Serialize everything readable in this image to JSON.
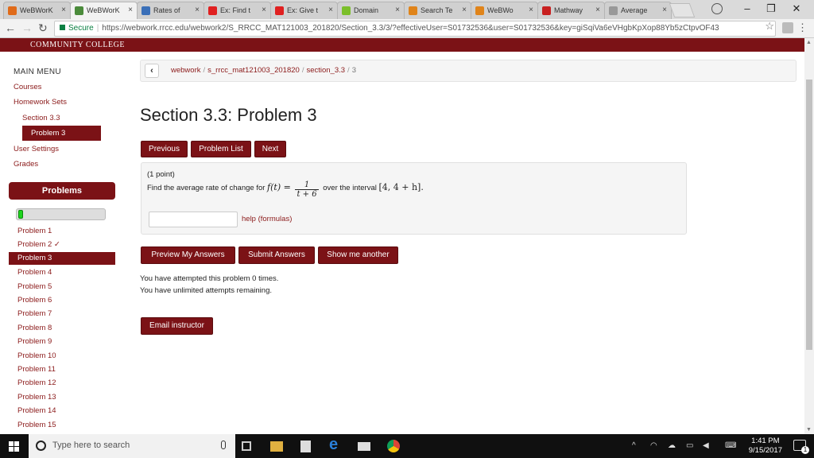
{
  "browser": {
    "tabs": [
      {
        "label": "WeBWorK",
        "favicon_color": "#e06b1a",
        "active": false
      },
      {
        "label": "WeBWorK",
        "favicon_color": "#4b8b3b",
        "active": true
      },
      {
        "label": "Rates of",
        "favicon_color": "#3a6fb8",
        "active": false
      },
      {
        "label": "Ex: Find t",
        "favicon_color": "#e02020",
        "active": false
      },
      {
        "label": "Ex: Give t",
        "favicon_color": "#e02020",
        "active": false
      },
      {
        "label": "Domain",
        "favicon_color": "#7bbf2a",
        "active": false
      },
      {
        "label": "Search Te",
        "favicon_color": "#e0841a",
        "active": false
      },
      {
        "label": "WeBWo",
        "favicon_color": "#e0841a",
        "active": false
      },
      {
        "label": "Mathway",
        "favicon_color": "#c82020",
        "active": false
      },
      {
        "label": "Average",
        "favicon_color": "#999999",
        "active": false
      }
    ],
    "secure_label": "Secure",
    "url": "https://webwork.rrcc.edu/webwork2/S_RRCC_MAT121003_201820/Section_3.3/3/?effectiveUser=S01732536&user=S01732536&key=giSqiVa6eVHgbKpXop88Yb5zCtpvOF43"
  },
  "banner": {
    "text": "COMMUNITY COLLEGE"
  },
  "sidebar": {
    "title": "MAIN MENU",
    "links": [
      "Courses",
      "Homework Sets",
      "Section 3.3",
      "Problem 3",
      "User Settings",
      "Grades"
    ],
    "problems_title": "Problems",
    "progress": 0.04,
    "problems": [
      "Problem 1",
      "Problem 2 ✓",
      "Problem 3",
      "Problem 4",
      "Problem 5",
      "Problem 6",
      "Problem 7",
      "Problem 8",
      "Problem 9",
      "Problem 10",
      "Problem 11",
      "Problem 12",
      "Problem 13",
      "Problem 14",
      "Problem 15"
    ],
    "active_problem": "Problem 3"
  },
  "breadcrumb": {
    "items": [
      "webwork",
      "s_rrcc_mat121003_201820",
      "section_3.3"
    ],
    "last": "3"
  },
  "main": {
    "title": "Section 3.3: Problem 3",
    "nav_buttons": {
      "previous": "Previous",
      "problem_list": "Problem List",
      "next": "Next"
    },
    "points": "(1 point)",
    "question_pre": "Find the average rate of change for",
    "func": "f(t) =",
    "frac_num": "1",
    "frac_den": "t + 6",
    "question_mid": "over the interval",
    "interval": "[4, 4 + h].",
    "answer_value": "",
    "help_link": "help (formulas)",
    "action_buttons": {
      "preview": "Preview My Answers",
      "submit": "Submit Answers",
      "another": "Show me another"
    },
    "attempts_line1": "You have attempted this problem 0 times.",
    "attempts_line2": "You have unlimited attempts remaining.",
    "email_button": "Email instructor"
  },
  "taskbar": {
    "search_placeholder": "Type here to search",
    "time": "1:41 PM",
    "date": "9/15/2017",
    "notification_count": "1"
  }
}
